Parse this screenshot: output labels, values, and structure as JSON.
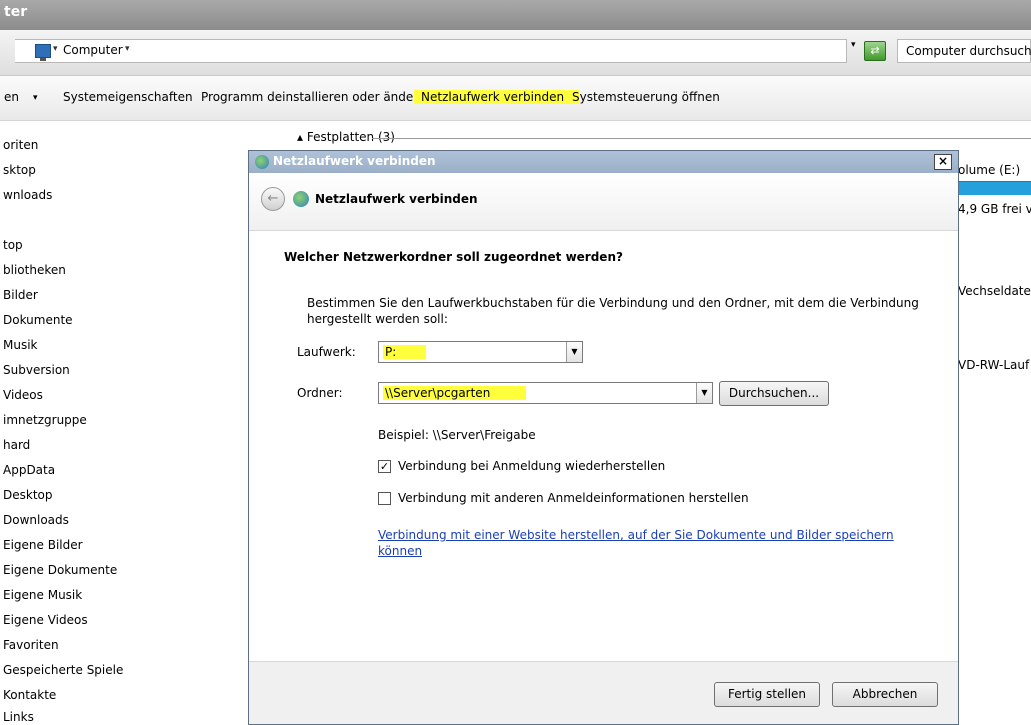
{
  "explorer": {
    "title": "ter",
    "address": {
      "crumb": "Computer",
      "arrow": "▾",
      "search_placeholder": "Computer durchsuchen"
    },
    "commands": {
      "organize": "en",
      "system_properties": "Systemeigenschaften",
      "uninstall": "Programm deinstallieren oder ändern",
      "map_drive": "Netzlaufwerk verbinden",
      "control_panel": "Systemsteuerung öffnen"
    },
    "nav_items": [
      "oriten",
      "sktop",
      "wnloads",
      "",
      "top",
      "bliotheken",
      "Bilder",
      "Dokumente",
      "Musik",
      "Subversion",
      "Videos",
      "imnetzgruppe",
      "hard",
      "AppData",
      "Desktop",
      "Downloads",
      "Eigene Bilder",
      "Eigene Dokumente",
      "Eigene Musik",
      "Eigene Videos",
      "Favoriten",
      "Gespeicherte Spiele",
      "Kontakte",
      "Links"
    ],
    "group_header": "Festplatten (3)",
    "right_items": {
      "volume": "olume (E:)",
      "free": "4,9 GB frei v",
      "removable": "Vechseldaten",
      "dvd": "VD-RW-Lauf"
    }
  },
  "dialog": {
    "title": "Netzlaufwerk verbinden",
    "close": "×",
    "wizard_title": "Netzlaufwerk verbinden",
    "question": "Welcher Netzwerkordner soll zugeordnet werden?",
    "description": "Bestimmen Sie den Laufwerkbuchstaben für die Verbindung und den Ordner, mit dem die Verbindung hergestellt werden soll:",
    "drive_label": "Laufwerk:",
    "drive_value": "P:",
    "folder_label": "Ordner:",
    "folder_value": "\\\\Server\\pcgarten",
    "browse": "Durchsuchen...",
    "example": "Beispiel: \\\\Server\\Freigabe",
    "reconnect_label": "Verbindung bei Anmeldung wiederherstellen",
    "reconnect_checked": true,
    "other_creds_label": "Verbindung mit anderen Anmeldeinformationen herstellen",
    "other_creds_checked": false,
    "link": "Verbindung mit einer Website herstellen, auf der Sie Dokumente und Bilder speichern können",
    "finish": "Fertig stellen",
    "cancel": "Abbrechen"
  },
  "colors": {
    "highlight": "#ffff3b",
    "link": "#1b3fb5",
    "selection": "#26a0da"
  }
}
